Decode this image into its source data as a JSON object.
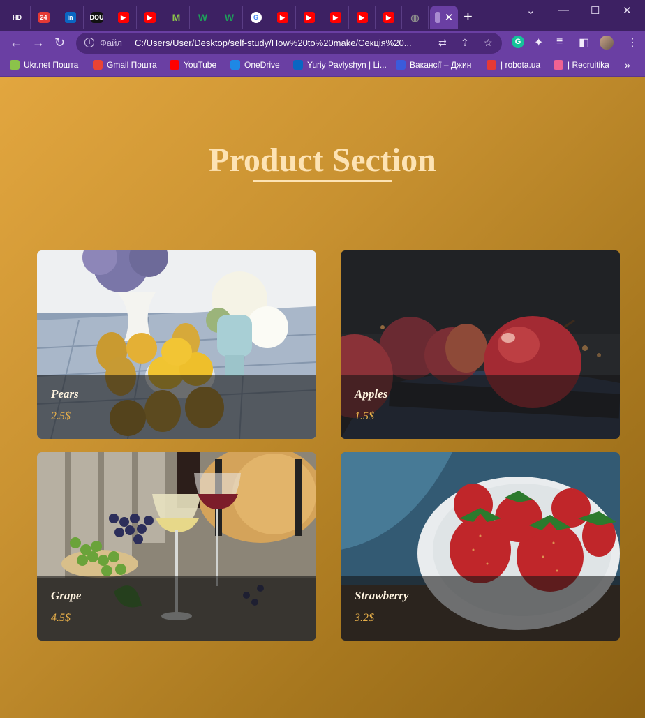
{
  "browser": {
    "tabs": [
      {
        "icon": "hd-icon",
        "text": "HD",
        "color": "#3d2163"
      },
      {
        "icon": "channel-24-icon",
        "text": "24",
        "color": "#e53935"
      },
      {
        "icon": "linkedin-icon",
        "text": "in",
        "color": "#0a66c2"
      },
      {
        "icon": "dou-icon",
        "text": "DOU",
        "color": "#111111"
      },
      {
        "icon": "youtube-icon",
        "text": "▶",
        "color": "#ff0000"
      },
      {
        "icon": "youtube-icon",
        "text": "▶",
        "color": "#ff0000"
      },
      {
        "icon": "m-logo-icon",
        "text": "M",
        "color": "#8bc34a"
      },
      {
        "icon": "w-logo-icon",
        "text": "W",
        "color": "#1e9e5a"
      },
      {
        "icon": "w-logo-icon",
        "text": "W",
        "color": "#1e9e5a"
      },
      {
        "icon": "google-icon",
        "text": "G",
        "color": "#ffffff"
      },
      {
        "icon": "youtube-icon",
        "text": "▶",
        "color": "#ff0000"
      },
      {
        "icon": "youtube-icon",
        "text": "▶",
        "color": "#ff0000"
      },
      {
        "icon": "youtube-icon",
        "text": "▶",
        "color": "#ff0000"
      },
      {
        "icon": "youtube-icon",
        "text": "▶",
        "color": "#ff0000"
      },
      {
        "icon": "youtube-icon",
        "text": "▶",
        "color": "#ff0000"
      },
      {
        "icon": "globe-icon",
        "text": "◍",
        "color": "#8a8a8a"
      }
    ],
    "active_tab_close": "✕",
    "new_tab": "+",
    "window_controls": {
      "minimize": "—",
      "maximize": "☐",
      "close": "✕",
      "dropdown": "⌄"
    },
    "address": {
      "scheme_label": "Файл",
      "url": "C:/Users/User/Desktop/self-study/How%20to%20make/Секція%20..."
    },
    "bookmarks": [
      {
        "icon": "ukrnet-icon",
        "label": "Ukr.net Пошта",
        "color": "#8bc34a"
      },
      {
        "icon": "gmail-icon",
        "label": "Gmail Пошта",
        "color": "#ea4335"
      },
      {
        "icon": "youtube-icon",
        "label": "YouTube",
        "color": "#ff0000"
      },
      {
        "icon": "onedrive-icon",
        "label": "OneDrive",
        "color": "#1e88e5"
      },
      {
        "icon": "linkedin-icon",
        "label": "Yuriy Pavlyshyn | Li...",
        "color": "#0a66c2"
      },
      {
        "icon": "djinni-icon",
        "label": "Вакансії – Джин",
        "color": "#3b5bdb"
      },
      {
        "icon": "robota-icon",
        "label": "| robota.ua",
        "color": "#e53935"
      },
      {
        "icon": "recruitika-icon",
        "label": "| Recruitika",
        "color": "#f06292"
      }
    ],
    "more_bookmarks": "»"
  },
  "page": {
    "title": "Product Section",
    "products": [
      {
        "name": "Pears",
        "price": "2.5$"
      },
      {
        "name": "Apples",
        "price": "1.5$"
      },
      {
        "name": "Grape",
        "price": "4.5$"
      },
      {
        "name": "Strawberry",
        "price": "3.2$"
      }
    ]
  }
}
